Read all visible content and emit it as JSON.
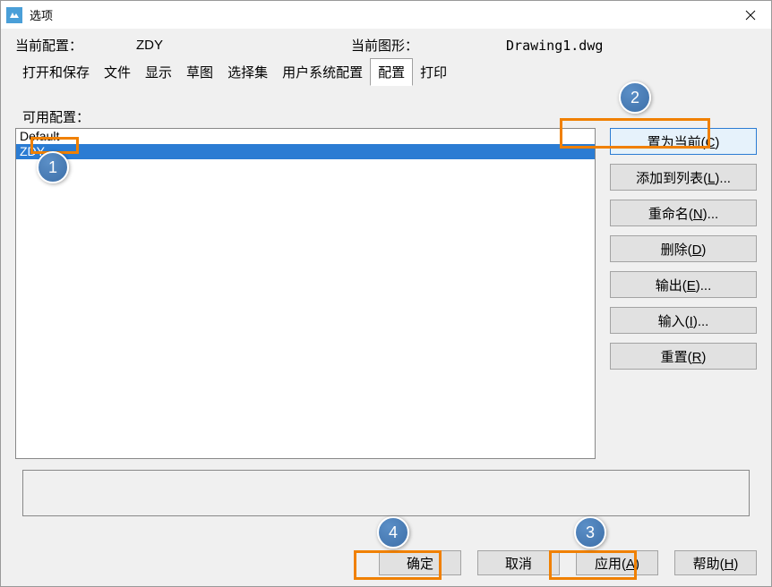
{
  "window": {
    "title": "选项"
  },
  "info": {
    "current_config_label": "当前配置：",
    "current_config_value": "ZDY",
    "current_drawing_label": "当前图形：",
    "current_drawing_value": "Drawing1.dwg"
  },
  "tabs": {
    "items": [
      {
        "label": "打开和保存"
      },
      {
        "label": "文件"
      },
      {
        "label": "显示"
      },
      {
        "label": "草图"
      },
      {
        "label": "选择集"
      },
      {
        "label": "用户系统配置"
      },
      {
        "label": "配置",
        "active": true
      },
      {
        "label": "打印"
      }
    ]
  },
  "available": {
    "label": "可用配置：",
    "items": [
      {
        "label": "Default",
        "selected": false
      },
      {
        "label": "ZDY",
        "selected": true
      }
    ]
  },
  "side_buttons": {
    "set_current": "置为当前(C)",
    "add_to_list": "添加到列表(L)...",
    "rename": "重命名(N)...",
    "delete": "删除(D)",
    "export": "输出(E)...",
    "import": "输入(I)...",
    "reset": "重置(R)"
  },
  "footer": {
    "ok": "确定",
    "cancel": "取消",
    "apply": "应用(A)",
    "help": "帮助(H)"
  },
  "callouts": {
    "c1": "1",
    "c2": "2",
    "c3": "3",
    "c4": "4"
  }
}
